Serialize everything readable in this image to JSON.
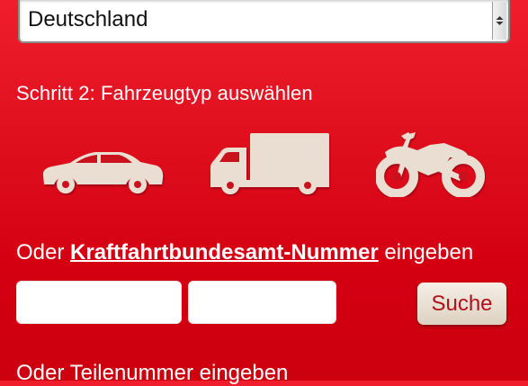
{
  "country_select": {
    "value": "Deutschland"
  },
  "step2": {
    "label": "Schritt 2: Fahrzeugtyp auswählen"
  },
  "vehicles": [
    {
      "type": "car",
      "icon": "car-icon"
    },
    {
      "type": "truck",
      "icon": "truck-icon"
    },
    {
      "type": "motorcycle",
      "icon": "motorcycle-icon"
    }
  ],
  "kba": {
    "prefix": "Oder ",
    "link": "Kraftfahrtbundesamt-Nummer",
    "suffix": " eingeben",
    "input1_value": "",
    "input2_value": "",
    "search_label": "Suche"
  },
  "part_number": {
    "label": "Oder Teilenummer eingeben"
  },
  "colors": {
    "background": "#dd0a18",
    "icon": "#e9ded1",
    "button_text": "#b0101a"
  }
}
